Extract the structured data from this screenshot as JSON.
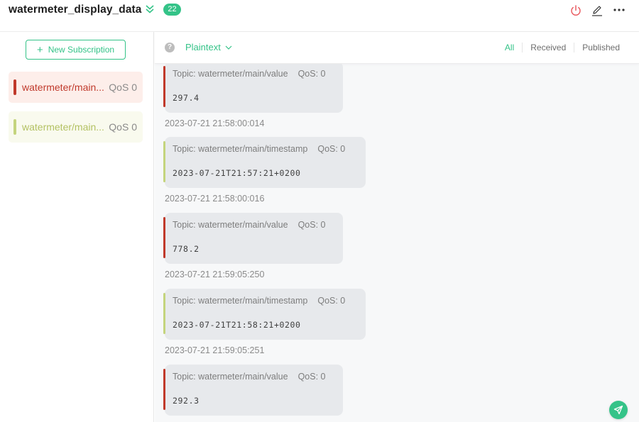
{
  "header": {
    "connection_name": "watermeter_display_data",
    "message_count": "22",
    "icons": [
      "collapse-icon",
      "power-icon",
      "edit-icon",
      "more-icon"
    ]
  },
  "sidebar": {
    "new_subscription_label": "New Subscription",
    "subscriptions": [
      {
        "topic": "watermeter/main...",
        "qos": "QoS 0",
        "color": "#c0392b",
        "bg": "#fdeeea",
        "text_color": "#c0392b"
      },
      {
        "topic": "watermeter/main...",
        "qos": "QoS 0",
        "color": "#c4d47d",
        "bg": "#f9faee",
        "text_color": "#b3c162"
      }
    ]
  },
  "toolbar": {
    "payload_format": "Plaintext",
    "filters": [
      "All",
      "Received",
      "Published"
    ],
    "active_filter": "All"
  },
  "messages": [
    {
      "topic": "Topic: watermeter/main/value",
      "qos": "QoS: 0",
      "payload": "297.4",
      "time": "2023-07-21 21:58:00:014",
      "color": "#c0392b"
    },
    {
      "topic": "Topic: watermeter/main/timestamp",
      "qos": "QoS: 0",
      "payload": "2023-07-21T21:57:21+0200",
      "time": "2023-07-21 21:58:00:016",
      "color": "#c4d47d"
    },
    {
      "topic": "Topic: watermeter/main/value",
      "qos": "QoS: 0",
      "payload": "778.2",
      "time": "2023-07-21 21:59:05:250",
      "color": "#c0392b"
    },
    {
      "topic": "Topic: watermeter/main/timestamp",
      "qos": "QoS: 0",
      "payload": "2023-07-21T21:58:21+0200",
      "time": "2023-07-21 21:59:05:251",
      "color": "#c4d47d"
    },
    {
      "topic": "Topic: watermeter/main/value",
      "qos": "QoS: 0",
      "payload": "292.3",
      "time": "",
      "color": "#c0392b"
    }
  ],
  "colors": {
    "accent": "#34c388",
    "danger": "#e8545a"
  }
}
